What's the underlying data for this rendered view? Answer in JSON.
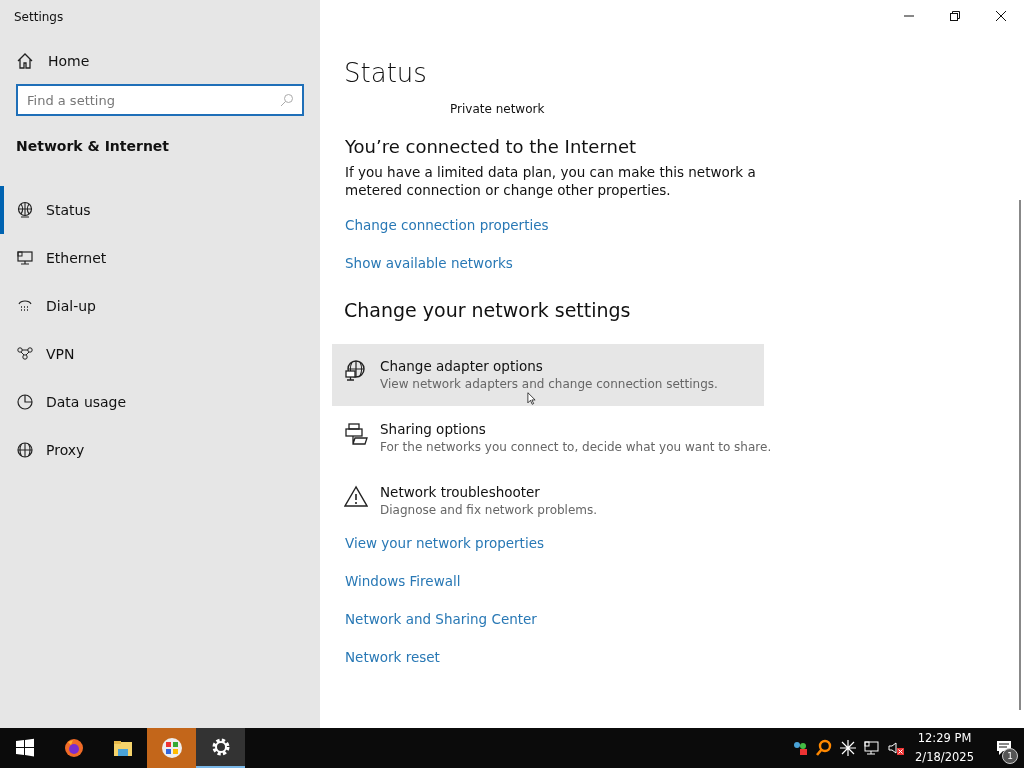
{
  "window": {
    "title": "Settings"
  },
  "sidebar": {
    "home": "Home",
    "search": {
      "placeholder": "Find a setting"
    },
    "section": "Network & Internet",
    "items": [
      {
        "label": "Status",
        "selected": true
      },
      {
        "label": "Ethernet",
        "selected": false
      },
      {
        "label": "Dial-up",
        "selected": false
      },
      {
        "label": "VPN",
        "selected": false
      },
      {
        "label": "Data usage",
        "selected": false
      },
      {
        "label": "Proxy",
        "selected": false
      }
    ]
  },
  "main": {
    "title": "Status",
    "network_profile": "Private network",
    "connection_heading": "You’re connected to the Internet",
    "connection_text": "If you have a limited data plan, you can make this network a metered connection or change other properties.",
    "links": [
      "Change connection properties",
      "Show available networks"
    ],
    "section": "Change your network settings",
    "options": [
      {
        "title": "Change adapter options",
        "description": "View network adapters and change connection settings.",
        "hovered": true
      },
      {
        "title": "Sharing options",
        "description": "For the networks you connect to, decide what you want to share.",
        "hovered": false
      },
      {
        "title": "Network troubleshooter",
        "description": "Diagnose and fix network problems.",
        "hovered": false
      }
    ],
    "more_links": [
      "View your network properties",
      "Windows Firewall",
      "Network and Sharing Center",
      "Network reset"
    ]
  },
  "taskbar": {
    "apps": [
      {
        "kind": "browser",
        "selected": false,
        "flashing": false
      },
      {
        "kind": "folder",
        "selected": false,
        "flashing": false
      },
      {
        "kind": "app",
        "selected": false,
        "flashing": true
      },
      {
        "kind": "settings",
        "selected": true,
        "flashing": false
      }
    ],
    "time": "12:29 PM",
    "date": "2/18/2025",
    "notification_count": "1"
  }
}
